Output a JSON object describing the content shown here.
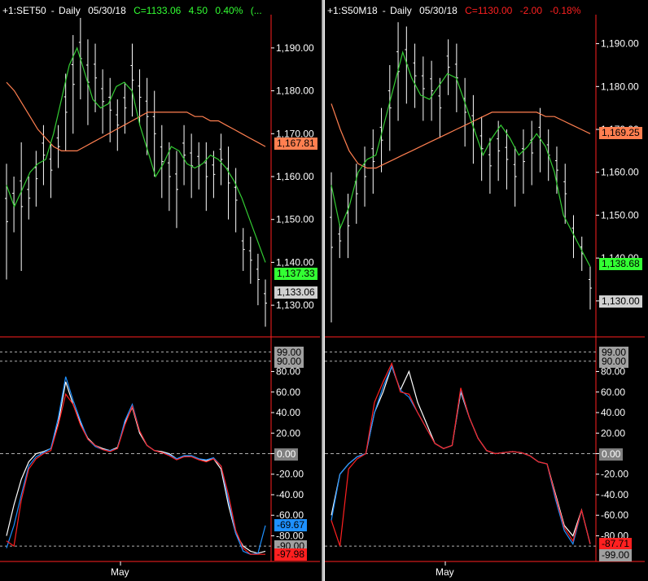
{
  "colors": {
    "background": "#000000",
    "price_bar": "#ffffff",
    "ma_short": "#33cc33",
    "ma_long": "#ff7f50",
    "osc_white": "#ffffff",
    "osc_blue": "#1e90ff",
    "osc_red": "#ff2020",
    "axis_line": "#ff2020",
    "change_up": "#33ff33",
    "change_down": "#ff2020"
  },
  "panels": [
    {
      "id": "left",
      "header": {
        "symbol": "+1:SET50",
        "period": "Daily",
        "date": "05/30/18",
        "close": "C=1133.06",
        "change": "4.50",
        "pct": "0.40%",
        "extra": "(...",
        "direction": "up"
      },
      "price_axis": {
        "ymin": 1123.0,
        "ymax": 1197.0,
        "ticks": [
          "1,190.00",
          "1,180.00",
          "1,170.00",
          "1,160.00",
          "1,150.00",
          "1,140.00",
          "1,130.00"
        ],
        "tick_values": [
          1190,
          1180,
          1170,
          1160,
          1150,
          1140,
          1130
        ]
      },
      "price_tags": [
        {
          "label": "1,167.81",
          "value": 1167.81,
          "bg": "#ff7f50",
          "fg": "#000000"
        },
        {
          "label": "1,137.33",
          "value": 1137.33,
          "bg": "#33ff33",
          "fg": "#000000"
        },
        {
          "label": "1,133.06",
          "value": 1133.06,
          "bg": "#d0d0d0",
          "fg": "#000000"
        }
      ],
      "osc_axis": {
        "ticks": [
          "80.00",
          "60.00",
          "40.00",
          "20.00",
          "0.00",
          "-20.00",
          "-40.00",
          "-60.00",
          "-80.00"
        ],
        "tick_values": [
          80,
          60,
          40,
          20,
          0,
          -20,
          -40,
          -60,
          -80
        ],
        "ref_lines": [
          "99.00",
          "90.00",
          "-90.00"
        ]
      },
      "osc_tags": [
        {
          "label": "99.00",
          "value": 99,
          "bg": "#a0a0a0",
          "fg": "#000000"
        },
        {
          "label": "90.00",
          "value": 90,
          "bg": "#a0a0a0",
          "fg": "#000000"
        },
        {
          "label": "0.00",
          "value": 0,
          "bg": "#808080",
          "fg": "#ffffff"
        },
        {
          "label": "-69.67",
          "value": -69.67,
          "bg": "#1e90ff",
          "fg": "#000000"
        },
        {
          "label": "-90.00",
          "value": -90,
          "bg": "#a0a0a0",
          "fg": "#000000"
        },
        {
          "label": "-97.98",
          "value": -97.98,
          "bg": "#ff2020",
          "fg": "#000000"
        }
      ],
      "month_label": "May",
      "bars": [
        [
          1163,
          1136
        ],
        [
          1160,
          1147
        ],
        [
          1168,
          1138
        ],
        [
          1160,
          1150
        ],
        [
          1166,
          1153
        ],
        [
          1172,
          1158
        ],
        [
          1168,
          1155
        ],
        [
          1172,
          1162
        ],
        [
          1184,
          1166
        ],
        [
          1193,
          1170
        ],
        [
          1197,
          1178
        ],
        [
          1192,
          1172
        ],
        [
          1191,
          1175
        ],
        [
          1185,
          1170
        ],
        [
          1183,
          1168
        ],
        [
          1178,
          1166
        ],
        [
          1182,
          1170
        ],
        [
          1191,
          1174
        ],
        [
          1185,
          1172
        ],
        [
          1183,
          1165
        ],
        [
          1180,
          1160
        ],
        [
          1172,
          1155
        ],
        [
          1168,
          1152
        ],
        [
          1166,
          1148
        ],
        [
          1172,
          1158
        ],
        [
          1170,
          1155
        ],
        [
          1168,
          1157
        ],
        [
          1168,
          1152
        ],
        [
          1166,
          1155
        ],
        [
          1170,
          1158
        ],
        [
          1167,
          1150
        ],
        [
          1162,
          1147
        ],
        [
          1148,
          1138
        ],
        [
          1146,
          1135
        ],
        [
          1142,
          1130
        ],
        [
          1136,
          1125
        ]
      ],
      "ma_short": [
        1158,
        1153,
        1157,
        1161,
        1163,
        1164,
        1170,
        1178,
        1186,
        1190,
        1184,
        1178,
        1176,
        1177,
        1181,
        1182,
        1180,
        1172,
        1166,
        1160,
        1163,
        1167,
        1166,
        1163,
        1162,
        1163,
        1165,
        1164,
        1162,
        1159,
        1155,
        1150,
        1145,
        1140
      ],
      "ma_long": [
        1182,
        1180,
        1177,
        1174,
        1171,
        1169,
        1167,
        1166,
        1166,
        1166,
        1167,
        1168,
        1169,
        1170,
        1171,
        1172,
        1173,
        1174,
        1175,
        1175,
        1175,
        1175,
        1175,
        1175,
        1174,
        1174,
        1173,
        1173,
        1172,
        1171,
        1170,
        1169,
        1168,
        1167
      ],
      "osc_white": [
        -80,
        -50,
        -25,
        -8,
        0,
        2,
        5,
        30,
        70,
        48,
        30,
        15,
        8,
        5,
        3,
        6,
        30,
        45,
        20,
        8,
        3,
        2,
        0,
        -5,
        -3,
        -2,
        -5,
        -7,
        -5,
        -15,
        -50,
        -78,
        -90,
        -95,
        -97,
        -95
      ],
      "osc_blue": [
        -92,
        -70,
        -40,
        -12,
        -3,
        1,
        5,
        35,
        75,
        52,
        32,
        14,
        7,
        4,
        3,
        5,
        32,
        48,
        22,
        8,
        3,
        1,
        -1,
        -5,
        -2,
        -2,
        -5,
        -6,
        -4,
        -12,
        -45,
        -78,
        -95,
        -98,
        -97,
        -70
      ],
      "osc_red": [
        -85,
        -90,
        -45,
        -15,
        -5,
        0,
        3,
        28,
        58,
        48,
        28,
        14,
        8,
        4,
        2,
        5,
        28,
        46,
        22,
        8,
        3,
        1,
        -2,
        -6,
        -3,
        -3,
        -6,
        -8,
        -5,
        -12,
        -40,
        -75,
        -92,
        -98,
        -98,
        -98
      ]
    },
    {
      "id": "right",
      "header": {
        "symbol": "+1:S50M18",
        "period": "Daily",
        "date": "05/30/18",
        "close": "C=1130.00",
        "change": "-2.00",
        "pct": "-0.18%",
        "extra": "",
        "direction": "down"
      },
      "price_axis": {
        "ymin": 1122.0,
        "ymax": 1196.0,
        "ticks": [
          "1,190.00",
          "1,180.00",
          "1,170.00",
          "1,160.00",
          "1,150.00",
          "1,140.00",
          "1,130.00"
        ],
        "tick_values": [
          1190,
          1180,
          1170,
          1160,
          1150,
          1140,
          1130
        ]
      },
      "price_tags": [
        {
          "label": "1,169.25",
          "value": 1169.25,
          "bg": "#ff7f50",
          "fg": "#000000"
        },
        {
          "label": "1,138.68",
          "value": 1138.68,
          "bg": "#33ff33",
          "fg": "#000000"
        },
        {
          "label": "1,130.00",
          "value": 1130.0,
          "bg": "#d0d0d0",
          "fg": "#000000"
        }
      ],
      "osc_axis": {
        "ticks": [
          "80.00",
          "60.00",
          "40.00",
          "20.00",
          "0.00",
          "-20.00",
          "-40.00",
          "-60.00",
          "-80.00"
        ],
        "tick_values": [
          80,
          60,
          40,
          20,
          0,
          -20,
          -40,
          -60,
          -80
        ],
        "ref_lines": [
          "99.00",
          "90.00",
          "-90.00"
        ]
      },
      "osc_tags": [
        {
          "label": "99.00",
          "value": 99,
          "bg": "#a0a0a0",
          "fg": "#000000"
        },
        {
          "label": "90.00",
          "value": 90,
          "bg": "#a0a0a0",
          "fg": "#000000"
        },
        {
          "label": "0.00",
          "value": 0,
          "bg": "#808080",
          "fg": "#ffffff"
        },
        {
          "label": "-87.71",
          "value": -87.71,
          "bg": "#ff2020",
          "fg": "#000000"
        },
        {
          "label": "-99.00",
          "value": -99,
          "bg": "#a0a0a0",
          "fg": "#000000"
        }
      ],
      "month_label": "May",
      "bars": [
        [
          1160,
          1125
        ],
        [
          1148,
          1140
        ],
        [
          1155,
          1140
        ],
        [
          1162,
          1148
        ],
        [
          1166,
          1152
        ],
        [
          1170,
          1155
        ],
        [
          1175,
          1160
        ],
        [
          1185,
          1165
        ],
        [
          1195,
          1172
        ],
        [
          1194,
          1176
        ],
        [
          1190,
          1175
        ],
        [
          1187,
          1172
        ],
        [
          1186,
          1172
        ],
        [
          1182,
          1168
        ],
        [
          1191,
          1178
        ],
        [
          1190,
          1174
        ],
        [
          1182,
          1166
        ],
        [
          1178,
          1162
        ],
        [
          1173,
          1158
        ],
        [
          1168,
          1155
        ],
        [
          1172,
          1158
        ],
        [
          1170,
          1156
        ],
        [
          1166,
          1152
        ],
        [
          1170,
          1155
        ],
        [
          1172,
          1157
        ],
        [
          1175,
          1160
        ],
        [
          1170,
          1158
        ],
        [
          1166,
          1155
        ],
        [
          1162,
          1148
        ],
        [
          1150,
          1140
        ],
        [
          1145,
          1137
        ],
        [
          1138,
          1128
        ]
      ],
      "ma_short": [
        1157,
        1147,
        1152,
        1160,
        1163,
        1164,
        1172,
        1180,
        1188,
        1182,
        1178,
        1177,
        1180,
        1183,
        1182,
        1176,
        1170,
        1164,
        1168,
        1171,
        1168,
        1164,
        1166,
        1169,
        1166,
        1160,
        1150,
        1146,
        1142,
        1138
      ],
      "ma_long": [
        1176,
        1170,
        1165,
        1162,
        1161,
        1161,
        1162,
        1163,
        1164,
        1165,
        1166,
        1167,
        1168,
        1169,
        1170,
        1171,
        1172,
        1173,
        1174,
        1174,
        1174,
        1174,
        1174,
        1174,
        1173,
        1173,
        1172,
        1171,
        1170,
        1169
      ],
      "osc_white": [
        -60,
        -20,
        -10,
        -3,
        0,
        40,
        60,
        85,
        62,
        80,
        50,
        30,
        10,
        5,
        8,
        60,
        35,
        15,
        3,
        0,
        1,
        2,
        1,
        -2,
        -8,
        -10,
        -40,
        -70,
        -80,
        -55,
        -88
      ],
      "osc_blue": [
        -65,
        -20,
        -10,
        -3,
        0,
        40,
        65,
        85,
        62,
        55,
        40,
        25,
        10,
        5,
        8,
        62,
        35,
        15,
        3,
        0,
        1,
        2,
        1,
        -2,
        -8,
        -10,
        -45,
        -75,
        -88,
        -55,
        -88
      ],
      "osc_red": [
        -65,
        -90,
        -15,
        -5,
        0,
        50,
        70,
        88,
        60,
        58,
        40,
        25,
        10,
        5,
        8,
        64,
        35,
        15,
        3,
        0,
        1,
        2,
        1,
        -2,
        -8,
        -10,
        -42,
        -72,
        -85,
        -55,
        -88
      ]
    }
  ]
}
